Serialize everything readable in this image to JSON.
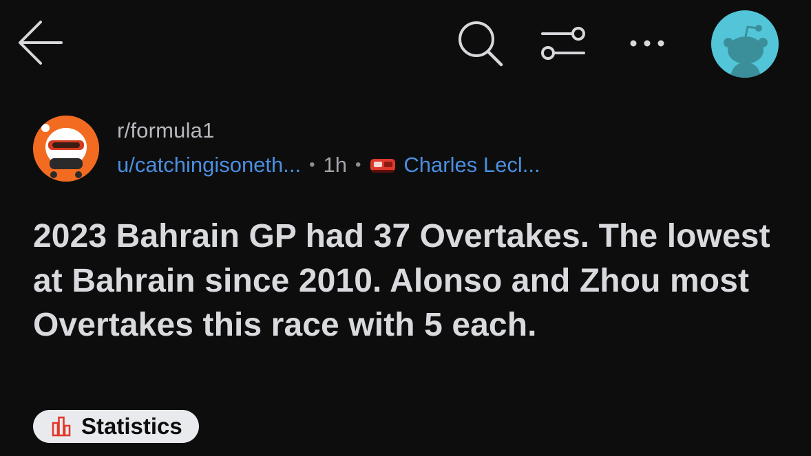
{
  "header": {
    "back_icon": "arrow-left-icon",
    "search_icon": "search-icon",
    "filter_icon": "sliders-icon",
    "more_icon": "more-horizontal-icon",
    "avatar_icon": "user-avatar-icon"
  },
  "post": {
    "subreddit": "r/formula1",
    "username": "u/catchingisoneth...",
    "time": "1h",
    "user_flair": "Charles Lecl...",
    "user_flair_icon": "ferrari-car-icon",
    "title": "2023 Bahrain GP had 37 Overtakes. The lowest at Bahrain since 2010. Alonso and Zhou most Overtakes this race with 5 each.",
    "post_flair": "Statistics",
    "post_flair_icon": "bar-chart-icon"
  },
  "colors": {
    "background": "#0d0d0e",
    "link_blue": "#4b8fe0",
    "avatar_cyan": "#52c6d8",
    "subreddit_orange": "#f26b21",
    "flair_icon_red": "#e0392b"
  }
}
